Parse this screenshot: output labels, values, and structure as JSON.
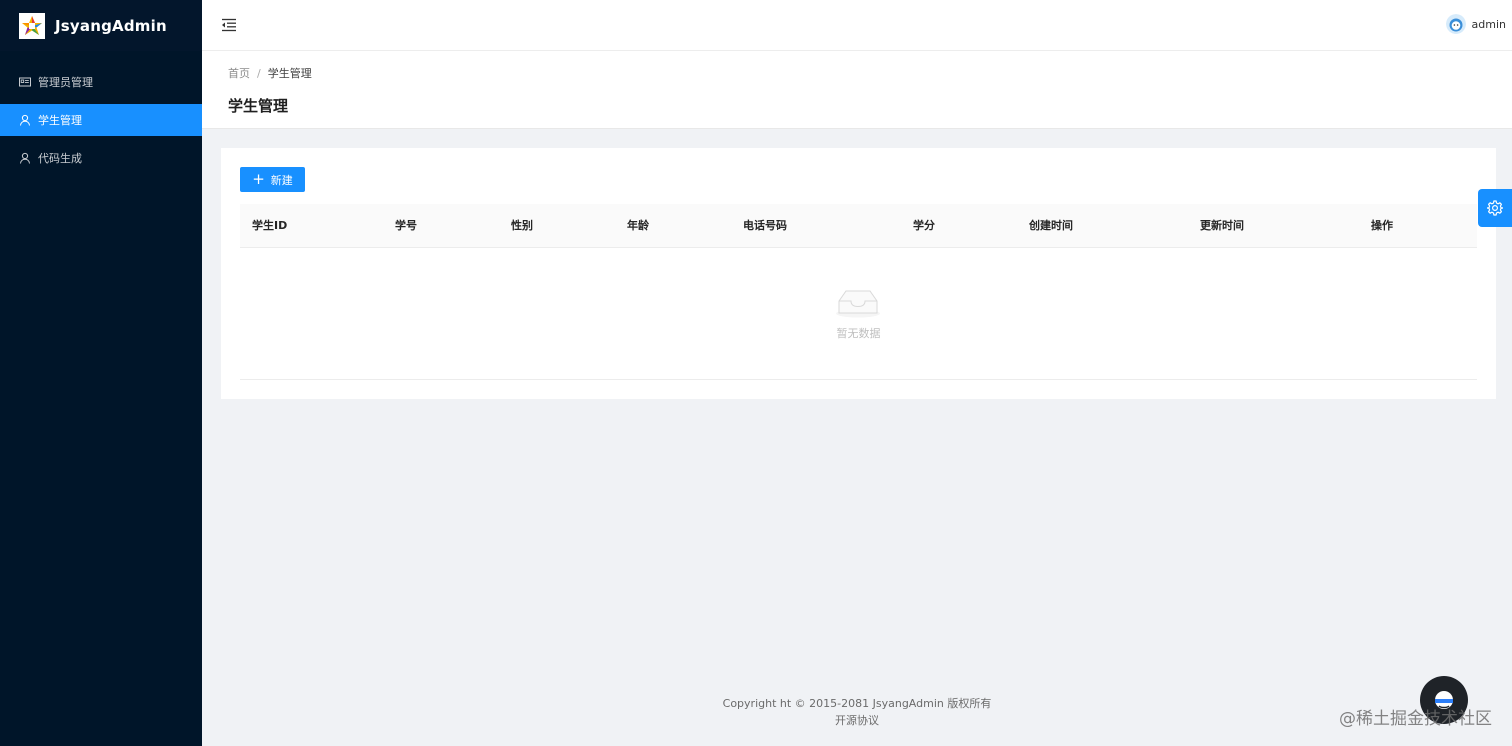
{
  "app": {
    "title": "JsyangAdmin"
  },
  "sidebar": {
    "items": [
      {
        "label": "管理员管理",
        "icon": "id-card-icon",
        "active": false
      },
      {
        "label": "学生管理",
        "icon": "user-icon",
        "active": true
      },
      {
        "label": "代码生成",
        "icon": "user-icon",
        "active": false
      }
    ]
  },
  "header": {
    "username": "admin"
  },
  "breadcrumb": {
    "home": "首页",
    "separator": "/",
    "current": "学生管理"
  },
  "page": {
    "title": "学生管理"
  },
  "toolbar": {
    "new_label": "新建",
    "new_icon": "+"
  },
  "table": {
    "columns": [
      "学生ID",
      "学号",
      "性别",
      "年龄",
      "电话号码",
      "学分",
      "创建时间",
      "更新时间",
      "操作"
    ],
    "rows": [],
    "empty_text": "暂无数据"
  },
  "footer": {
    "copyright": "Copyright ht © 2015-2081 JsyangAdmin 版权所有",
    "link": "开源协议"
  },
  "watermark": "@稀土掘金技术社区",
  "colors": {
    "primary": "#1890ff",
    "sidebar_bg": "#001529",
    "page_bg": "#f0f2f5"
  }
}
